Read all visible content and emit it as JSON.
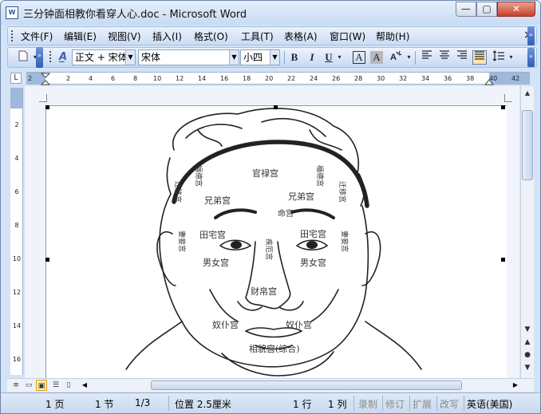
{
  "window": {
    "title": "三分钟面相教你看穿人心.doc - Microsoft Word",
    "icon": "W",
    "min_glyph": "—",
    "max_glyph": "▢",
    "close_glyph": "✕"
  },
  "menubar": {
    "items": [
      "文件(F)",
      "编辑(E)",
      "视图(V)",
      "插入(I)",
      "格式(O)",
      "工具(T)",
      "表格(A)",
      "窗口(W)",
      "帮助(H)"
    ],
    "close_glyph": "×"
  },
  "toolbar": {
    "style_icon": "A̲",
    "style_value": "正文 + 宋体",
    "font_value": "宋体",
    "size_value": "小四",
    "bold": "B",
    "italic": "I",
    "underline": "U",
    "char_border": "A",
    "char_shading": "A",
    "highlight": "ab"
  },
  "ruler": {
    "ticks": [
      "2",
      "2",
      "4",
      "6",
      "8",
      "10",
      "12",
      "14",
      "16",
      "18",
      "20",
      "22",
      "24",
      "26",
      "28",
      "30",
      "32",
      "34",
      "36",
      "38",
      "40",
      "42"
    ],
    "tab_glyph": "L"
  },
  "vruler": {
    "ticks": [
      "2",
      "4",
      "6",
      "8",
      "10",
      "12",
      "14",
      "16"
    ]
  },
  "face_labels": {
    "guanlu": "官禄宫",
    "fude_l": "福德宫",
    "fude_r": "福德宫",
    "qianyi_l": "迁移宫",
    "qianyi_r": "迁移宫",
    "xiongdi_l": "兄弟宫",
    "xiongdi_r": "兄弟宫",
    "ming": "命宫",
    "tianzhai_l": "田宅宫",
    "tianzhai_r": "田宅宫",
    "jie": "疾厄宫",
    "qiqie_l": "妻妾宫",
    "qiqie_r": "妻妾宫",
    "nannv_l": "男女宫",
    "nannv_r": "男女宫",
    "caibo": "财帛宫",
    "nupu_l": "奴仆宫",
    "nupu_r": "奴仆宫",
    "xiangmao": "相貌宫(综合)"
  },
  "status": {
    "page": "1 页",
    "section": "1 节",
    "pages": "1/3",
    "position": "位置 2.5厘米",
    "line": "1 行",
    "col": "1 列",
    "rec": "录制",
    "trk": "修订",
    "ext": "扩展",
    "ovr": "改写",
    "lang": "英语(美国)"
  }
}
